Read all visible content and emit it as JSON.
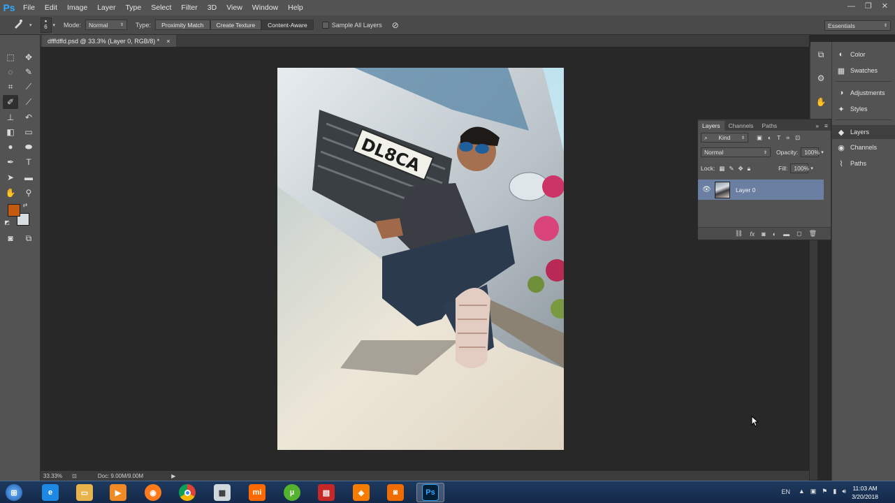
{
  "app": {
    "logo": "Ps"
  },
  "menu": [
    "File",
    "Edit",
    "Image",
    "Layer",
    "Type",
    "Select",
    "Filter",
    "3D",
    "View",
    "Window",
    "Help"
  ],
  "window_controls": {
    "minimize": "—",
    "restore": "❐",
    "close": "✕"
  },
  "options": {
    "brush_size": "6",
    "mode_label": "Mode:",
    "mode_value": "Normal",
    "type_label": "Type:",
    "type_buttons": [
      "Proximity Match",
      "Create Texture",
      "Content-Aware"
    ],
    "sample_all_layers": "Sample All Layers",
    "workspace": "Essentials"
  },
  "document": {
    "tab_title": "dfffdffd.psd @ 33.3% (Layer 0, RGB/8) *",
    "close": "×",
    "zoom": "33.33%",
    "doc_size": "Doc: 9.00M/9.00M"
  },
  "colors": {
    "foreground": "#c45a10",
    "background": "#d8dde2",
    "accent": "#31a8ff"
  },
  "right_panel": {
    "group1": [
      "Color",
      "Swatches"
    ],
    "group2": [
      "Adjustments",
      "Styles"
    ],
    "group3": [
      "Layers",
      "Channels",
      "Paths"
    ]
  },
  "layers_panel": {
    "tabs": [
      "Layers",
      "Channels",
      "Paths"
    ],
    "filter_kind": "Kind",
    "blend_mode": "Normal",
    "opacity_label": "Opacity:",
    "opacity_value": "100%",
    "lock_label": "Lock:",
    "fill_label": "Fill:",
    "fill_value": "100%",
    "layers": [
      {
        "name": "Layer 0",
        "visible": true
      }
    ]
  },
  "photo": {
    "plate_text": "DL8CA"
  },
  "taskbar": {
    "language": "EN",
    "time": "11:03 AM",
    "date": "3/20/2018"
  }
}
